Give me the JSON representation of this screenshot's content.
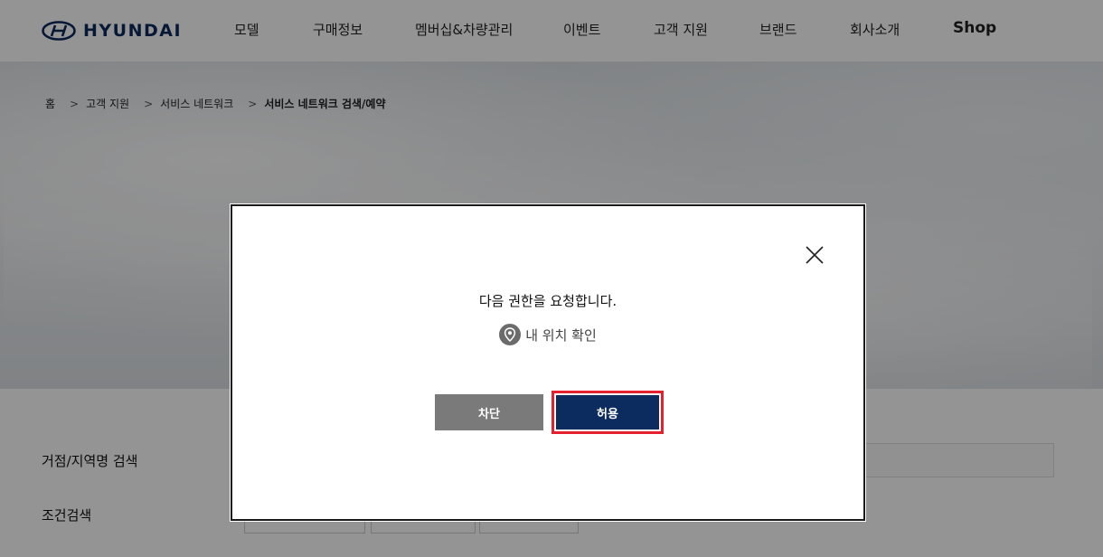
{
  "brand": {
    "name": "HYUNDAI"
  },
  "nav": {
    "items": [
      "모델",
      "구매정보",
      "멤버십&차량관리",
      "이벤트",
      "고객 지원",
      "브랜드",
      "회사소개"
    ],
    "shop_label": "Shop"
  },
  "breadcrumb": {
    "items": [
      "홈",
      "고객 지원",
      "서비스 네트워크",
      "서비스 네트워크 검색/예약"
    ]
  },
  "search": {
    "location_label": "거점/지역명 검색",
    "condition_label": "조건검색"
  },
  "modal": {
    "title": "다음 권한을 요청합니다.",
    "permission_label": "내 위치 확인",
    "block_label": "차단",
    "allow_label": "허용",
    "colors": {
      "allow": "#0c2b5e",
      "block": "#7a7a7a",
      "highlight": "#e5202f"
    },
    "icons": {
      "close": "close-icon",
      "permission": "location-pin-icon"
    }
  }
}
